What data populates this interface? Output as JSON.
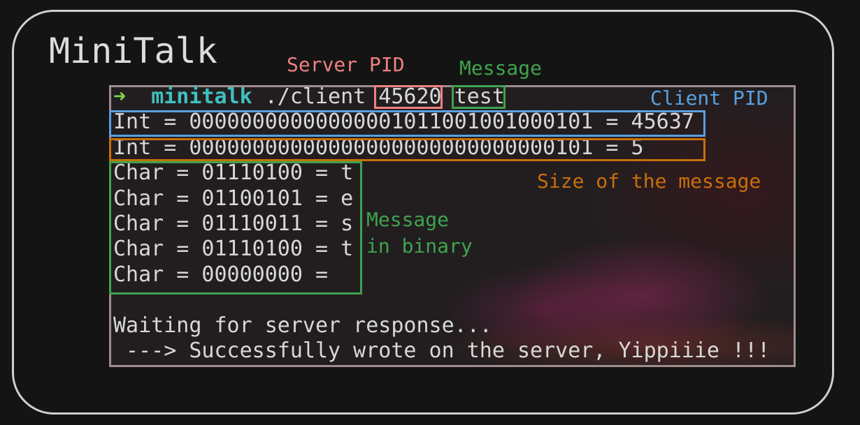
{
  "title": "MiniTalk",
  "annotations": {
    "server_pid": "Server PID",
    "message": "Message",
    "client_pid": "Client PID",
    "size": "Size of the message",
    "binary_1": "Message",
    "binary_2": "in binary"
  },
  "terminal": {
    "prompt_arrow": "➜",
    "prompt_dir": "minitalk",
    "command": "./client",
    "arg_pid": "45620",
    "arg_msg": "test",
    "lines": [
      "Int = 00000000000000001011001001000101 = 45637",
      "Int = 00000000000000000000000000000101 = 5",
      "Char = 01110100 = t",
      "Char = 01100101 = e",
      "Char = 01110011 = s",
      "Char = 01110100 = t",
      "Char = 00000000 =",
      "",
      "Waiting for server response...",
      " ---> Successfully wrote on the server, Yippiiie !!!"
    ]
  },
  "colors": {
    "server_pid": "#f08080",
    "message": "#3fa34d",
    "client_pid": "#5aa0e0",
    "size": "#c8700a"
  }
}
